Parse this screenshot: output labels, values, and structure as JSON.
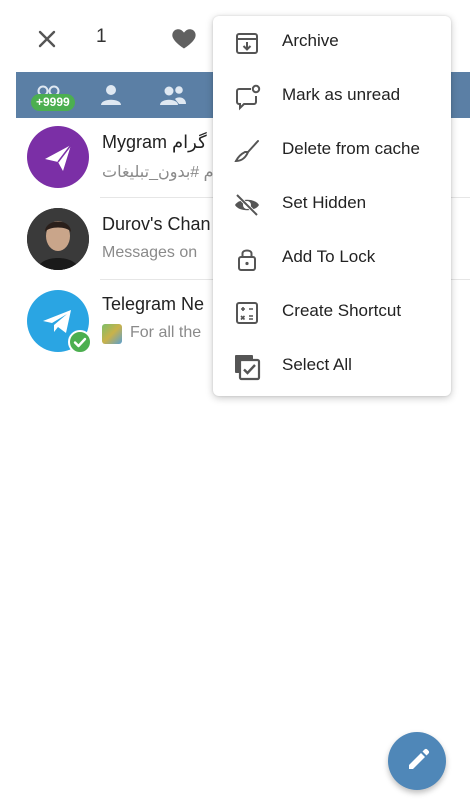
{
  "action_bar": {
    "selected_count": "1",
    "icons": {
      "close": "close-icon",
      "favorite": "heart-icon"
    }
  },
  "tabs": {
    "all_badge": "+9999",
    "icons": [
      "all-chats-icon",
      "user-icon",
      "group-icon"
    ]
  },
  "chats": [
    {
      "title": "Mygram گرام",
      "subtitle": "م #بدون_تبلیغات",
      "avatar_color": "#7b2fa6"
    },
    {
      "title": "Durov's Chan",
      "subtitle": "Messages on",
      "avatar_color": "#2b2b2b"
    },
    {
      "title": "Telegram Ne",
      "subtitle": "For all the",
      "avatar_color": "#2aa5e3"
    }
  ],
  "menu": {
    "items": [
      {
        "label": "Archive",
        "icon": "archive-icon"
      },
      {
        "label": "Mark as unread",
        "icon": "unread-icon"
      },
      {
        "label": "Delete from cache",
        "icon": "broom-icon"
      },
      {
        "label": "Set Hidden",
        "icon": "eye-off-icon"
      },
      {
        "label": "Add To Lock",
        "icon": "lock-icon"
      },
      {
        "label": "Create Shortcut",
        "icon": "calculator-icon"
      },
      {
        "label": "Select All",
        "icon": "select-all-icon"
      }
    ]
  },
  "colors": {
    "tabs_bar": "#5b7fa5",
    "badge": "#4caf50",
    "fab": "#4f87b8",
    "verified": "#4caf50"
  }
}
